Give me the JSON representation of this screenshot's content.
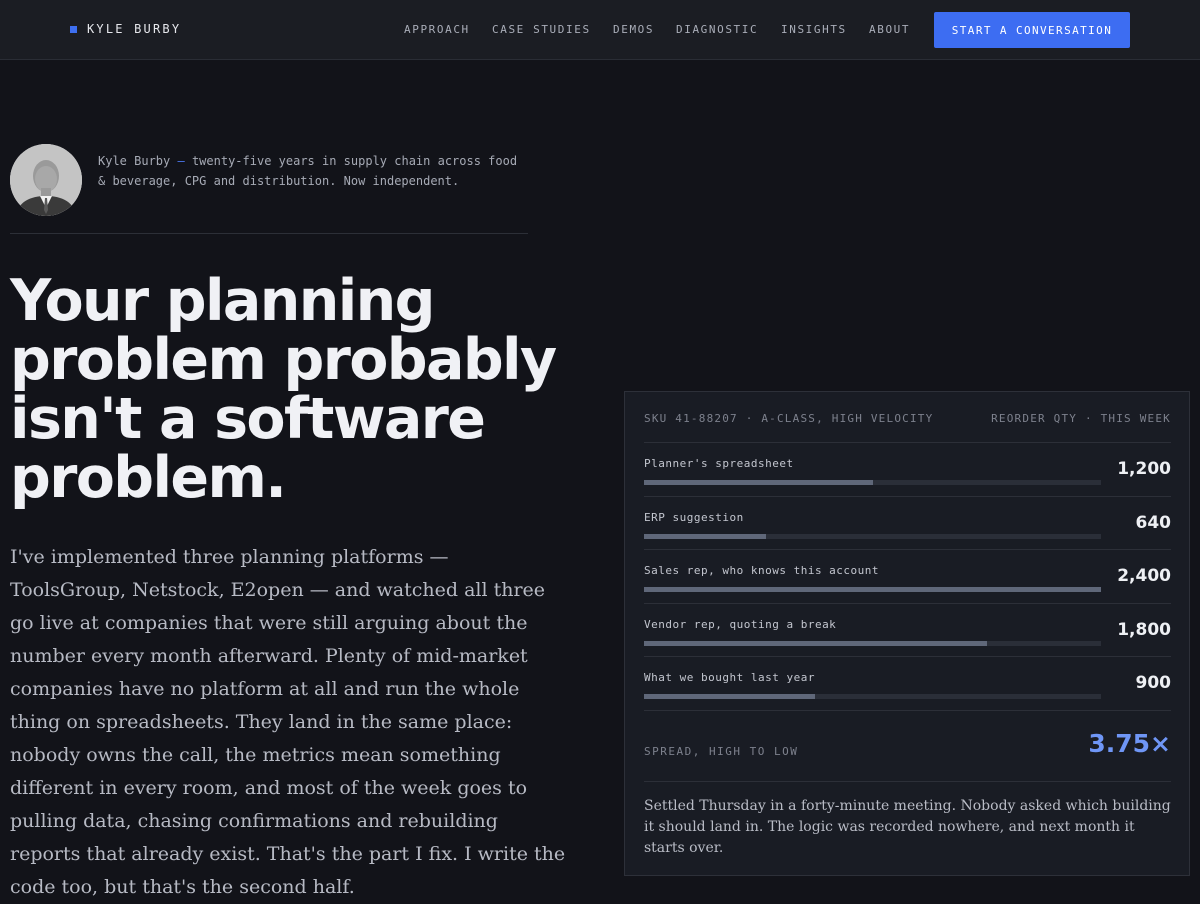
{
  "header": {
    "brand": "KYLE BURBY",
    "nav": [
      "APPROACH",
      "CASE STUDIES",
      "DEMOS",
      "DIAGNOSTIC",
      "INSIGHTS",
      "ABOUT"
    ],
    "cta_label": "START A CONVERSATION",
    "accent_color": "#3d6df2"
  },
  "author": {
    "name": "Kyle Burby",
    "separator": "—",
    "bio": "twenty-five years in supply chain across food & beverage, CPG and distribution. Now independent."
  },
  "hero": {
    "headline": "Your planning problem probably isn't a software problem.",
    "lede": "I've implemented three planning platforms — ToolsGroup, Netstock, E2open — and watched all three go live at companies that were still arguing about the number every month afterward. Plenty of mid-market companies have no platform at all and run the whole thing on spreadsheets. They land in the same place: nobody owns the call, the metrics mean something different in every room, and most of the week goes to pulling data, chasing confirmations and rebuilding reports that already exist. That's the part I fix. I write the code too, but that's the second half."
  },
  "card": {
    "sku_label": "SKU 41-88207 · A-CLASS, HIGH VELOCITY",
    "qty_label": "REORDER QTY · THIS WEEK",
    "rows": [
      {
        "label": "Planner's spreadsheet",
        "value": "1,200",
        "qty": 1200
      },
      {
        "label": "ERP suggestion",
        "value": "640",
        "qty": 640
      },
      {
        "label": "Sales rep, who knows this account",
        "value": "2,400",
        "qty": 2400
      },
      {
        "label": "Vendor rep, quoting a break",
        "value": "1,800",
        "qty": 1800
      },
      {
        "label": "What we bought last year",
        "value": "900",
        "qty": 900
      }
    ],
    "spread_label": "SPREAD, HIGH TO LOW",
    "spread_value": "3.75×",
    "spread_color": "#6f96f6",
    "note": "Settled Thursday in a forty-minute meeting. Nobody asked which building it should land in. The logic was recorded nowhere, and next month it starts over."
  }
}
